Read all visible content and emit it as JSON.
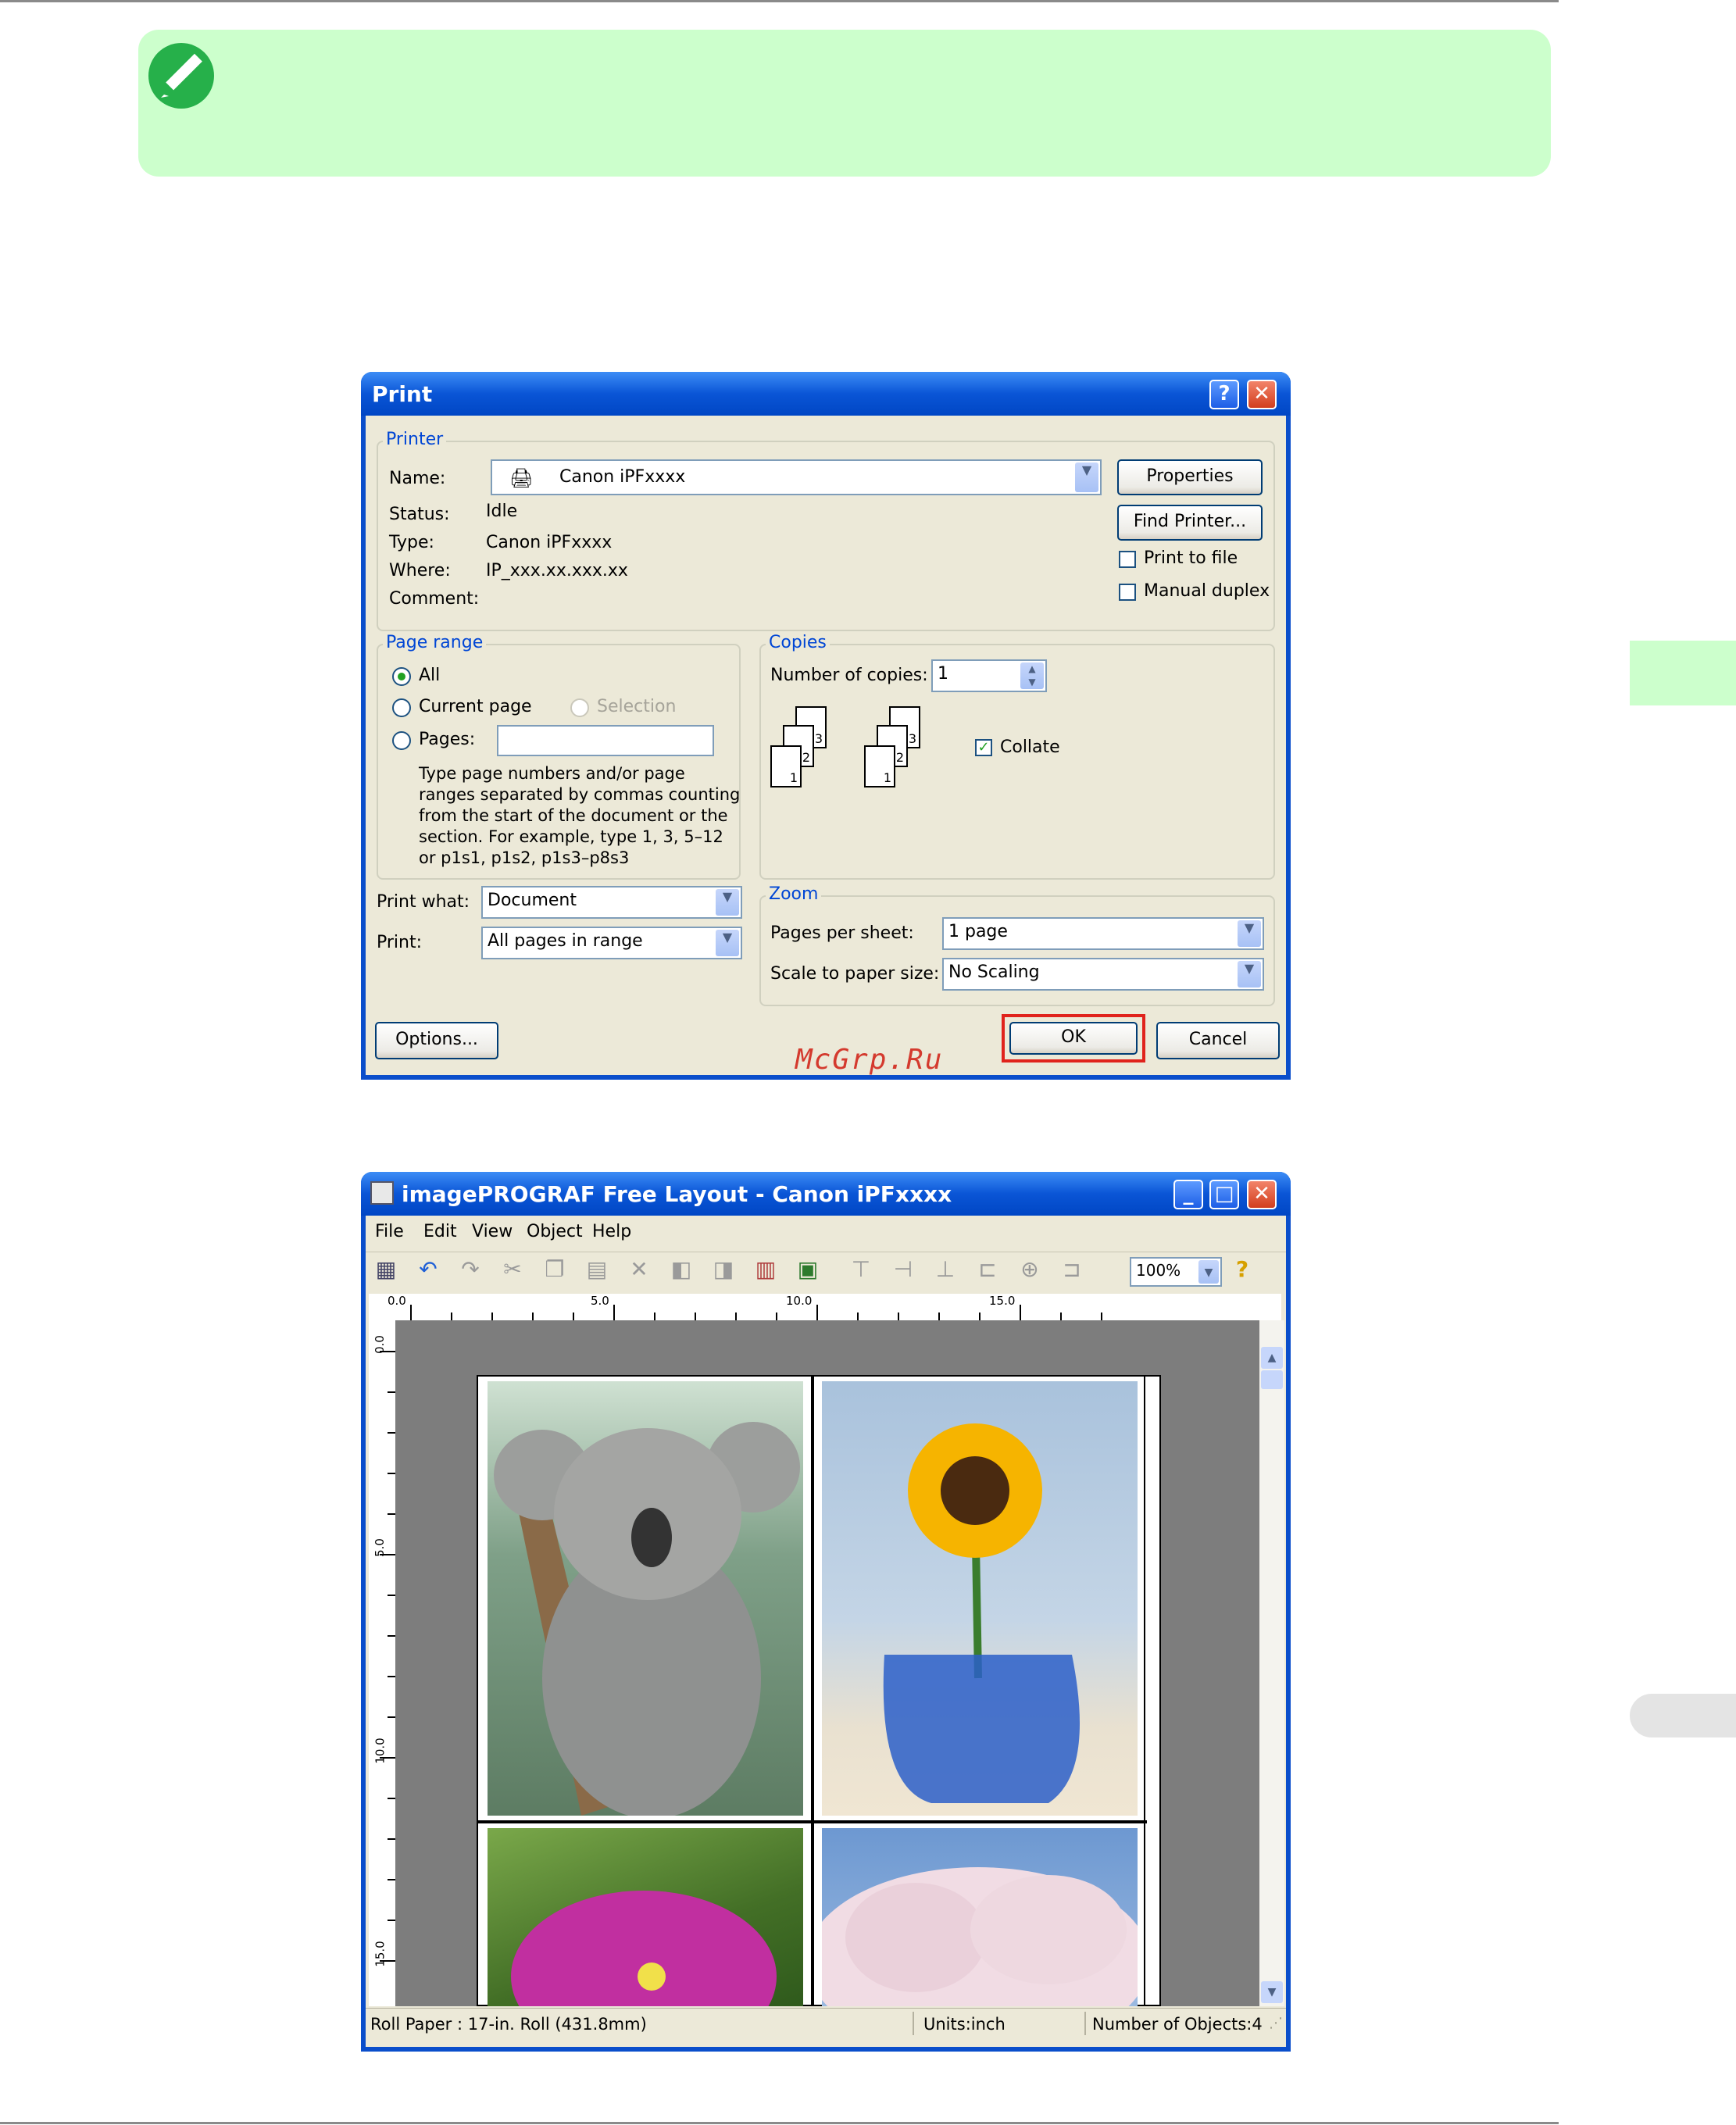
{
  "watermark": "McGrp.Ru",
  "print_dialog": {
    "title": "Print",
    "help_button": "?",
    "close_button": "✕",
    "printer": {
      "group_label": "Printer",
      "name_label": "Name:",
      "name_value": "Canon iPFxxxx",
      "status_label": "Status:",
      "status_value": "Idle",
      "type_label": "Type:",
      "type_value": "Canon iPFxxxx",
      "where_label": "Where:",
      "where_value": "IP_xxx.xx.xxx.xx",
      "comment_label": "Comment:",
      "properties_button": "Properties",
      "find_printer_button": "Find Printer...",
      "print_to_file": "Print to file",
      "manual_duplex": "Manual duplex"
    },
    "page_range": {
      "group_label": "Page range",
      "all": "All",
      "current_page": "Current page",
      "selection": "Selection",
      "pages": "Pages:",
      "help_text": [
        "Type page numbers and/or page",
        "ranges separated by commas counting",
        "from the start of the document or the",
        "section. For example, type 1, 3, 5–12",
        "or p1s1, p1s2, p1s3–p8s3"
      ]
    },
    "copies": {
      "group_label": "Copies",
      "number_label": "Number of copies:",
      "number_value": "1",
      "collate": "Collate",
      "page_labels": [
        "1",
        "2",
        "3"
      ]
    },
    "print_what_label": "Print what:",
    "print_what_value": "Document",
    "print_label": "Print:",
    "print_value": "All pages in range",
    "zoom": {
      "group_label": "Zoom",
      "pages_per_sheet_label": "Pages per sheet:",
      "pages_per_sheet_value": "1 page",
      "scale_label": "Scale to paper size:",
      "scale_value": "No Scaling"
    },
    "options_button": "Options...",
    "ok_button": "OK",
    "cancel_button": "Cancel",
    "colors": {
      "highlight": "#e0231c",
      "group_label": "#0046d5",
      "checkmark": "#21a121"
    }
  },
  "free_layout": {
    "title": "imagePROGRAF Free Layout - Canon iPFxxxx",
    "min_button": "_",
    "max_button": "□",
    "close_button": "✕",
    "menu": [
      "File",
      "Edit",
      "View",
      "Object",
      "Help"
    ],
    "zoom_value": "100%",
    "ruler_h": [
      "0.0",
      "5.0",
      "10.0",
      "15.0"
    ],
    "ruler_v": [
      "0.0",
      "5.0",
      "10.0",
      "15.0"
    ],
    "status": {
      "paper": "Roll Paper : 17-in. Roll (431.8mm)",
      "units": "Units:inch",
      "objects": "Number of Objects:4"
    },
    "photos": [
      "koala-photo",
      "sunflower-photo",
      "bougainvillea-photo",
      "cherry-blossom-photo"
    ]
  }
}
